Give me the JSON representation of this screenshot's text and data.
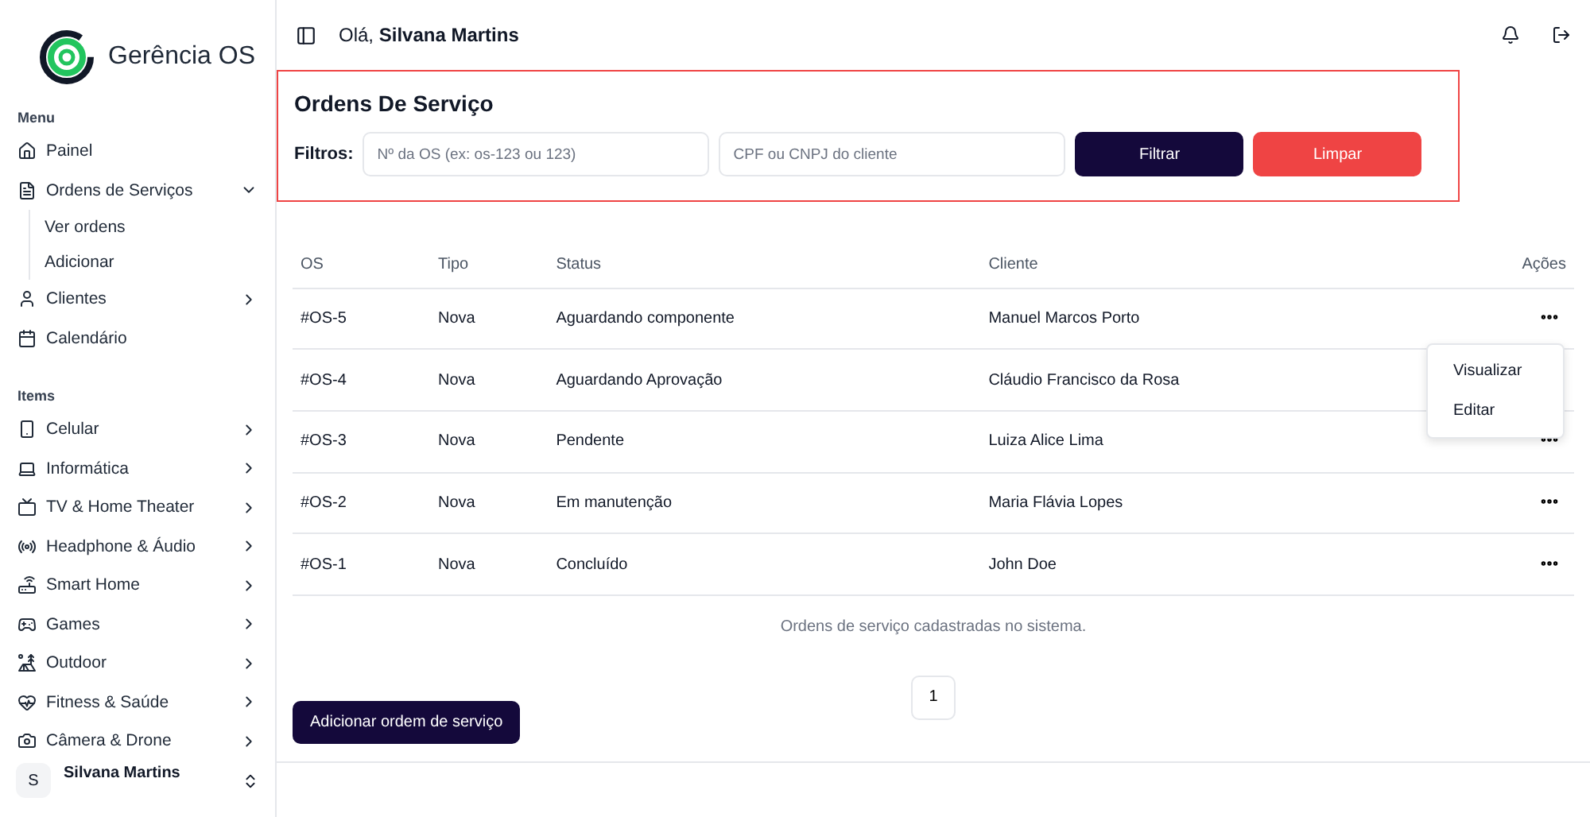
{
  "brand": {
    "name": "Gerência OS"
  },
  "sidebar": {
    "sections": [
      {
        "title": "Menu",
        "items": [
          {
            "label": "Painel"
          },
          {
            "label": "Ordens de Serviços",
            "expanded": true,
            "children": [
              {
                "label": "Ver ordens"
              },
              {
                "label": "Adicionar"
              }
            ]
          },
          {
            "label": "Clientes",
            "expanded": false
          },
          {
            "label": "Calendário"
          }
        ]
      },
      {
        "title": "Items",
        "items": [
          {
            "label": "Celular",
            "expanded": false
          },
          {
            "label": "Informática",
            "expanded": false
          },
          {
            "label": "TV & Home Theater",
            "expanded": false
          },
          {
            "label": "Headphone & Áudio",
            "expanded": false
          },
          {
            "label": "Smart Home",
            "expanded": false
          },
          {
            "label": "Games",
            "expanded": false
          },
          {
            "label": "Outdoor",
            "expanded": false
          },
          {
            "label": "Fitness & Saúde",
            "expanded": false
          },
          {
            "label": "Câmera & Drone",
            "expanded": false
          }
        ]
      }
    ],
    "user": {
      "initial": "S",
      "name": "Silvana Martins"
    }
  },
  "header": {
    "greeting": "Olá,",
    "name": "Silvana Martins"
  },
  "filter_card": {
    "title": "Ordens De Serviço",
    "label": "Filtros:",
    "fields": [
      {
        "placeholder": "Nº da OS (ex: os-123 ou 123)"
      },
      {
        "placeholder": "CPF ou CNPJ do cliente"
      }
    ],
    "buttons": [
      {
        "label": "Filtrar",
        "kind": "primary"
      },
      {
        "label": "Limpar",
        "kind": "danger"
      }
    ]
  },
  "table": {
    "columns": [
      "OS",
      "Tipo",
      "Status",
      "Cliente",
      "Ações"
    ],
    "rows": [
      {
        "os": "#OS-5",
        "tipo": "Nova",
        "status": "Aguardando componente",
        "cliente": "Manuel Marcos Porto"
      },
      {
        "os": "#OS-4",
        "tipo": "Nova",
        "status": "Aguardando Aprovação",
        "cliente": "Cláudio Francisco da Rosa"
      },
      {
        "os": "#OS-3",
        "tipo": "Nova",
        "status": "Pendente",
        "cliente": "Luiza Alice Lima"
      },
      {
        "os": "#OS-2",
        "tipo": "Nova",
        "status": "Em manutenção",
        "cliente": "Maria Flávia Lopes"
      },
      {
        "os": "#OS-1",
        "tipo": "Nova",
        "status": "Concluído",
        "cliente": "John Doe"
      }
    ],
    "menu": [
      "Visualizar",
      "Editar"
    ],
    "caption": "Ordens de serviço cadastradas no sistema."
  },
  "pagination": [
    {
      "label": "1",
      "selected": true
    }
  ],
  "add_button": "Adicionar ordem de serviço"
}
